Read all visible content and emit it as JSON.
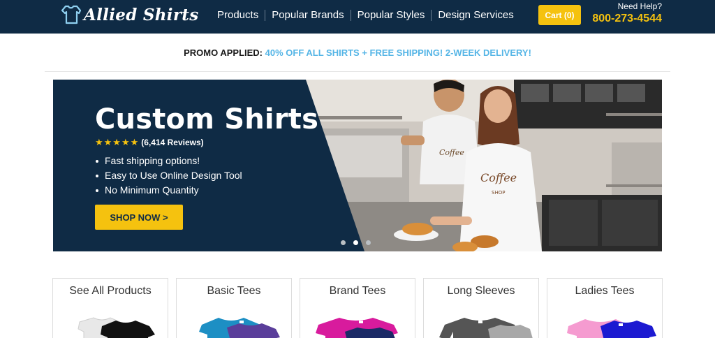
{
  "header": {
    "logo_text": "Allied Shirts",
    "nav": [
      "Products",
      "Popular Brands",
      "Popular Styles",
      "Design Services"
    ],
    "cart_label": "Cart (0)",
    "help_label": "Need Help?",
    "phone": "800-273-4544"
  },
  "promo": {
    "label": "PROMO APPLIED:",
    "text": "40% OFF ALL SHIRTS + FREE SHIPPING! 2-WEEK DELIVERY!"
  },
  "hero": {
    "title": "Custom Shirts",
    "rating_stars": 5,
    "stars_text": "★★★★★",
    "reviews": "(6,414 Reviews)",
    "bullets": [
      "Fast shipping options!",
      "Easy to Use Online Design Tool",
      "No Minimum Quantity"
    ],
    "cta": "SHOP NOW >",
    "slides": 3,
    "active_slide": 2,
    "shirt_prints": {
      "man": "Coffee",
      "woman": "Coffee",
      "woman_sub": "SHOP"
    }
  },
  "categories": [
    {
      "title": "See All Products",
      "colors": [
        "#e8e8e8",
        "#111111"
      ]
    },
    {
      "title": "Basic Tees",
      "colors": [
        "#1d8fc4",
        "#5a3e9a"
      ]
    },
    {
      "title": "Brand Tees",
      "colors": [
        "#d81b9d",
        "#1b2a66"
      ]
    },
    {
      "title": "Long Sleeves",
      "colors": [
        "#555555",
        "#a8a8a8"
      ]
    },
    {
      "title": "Ladies Tees",
      "colors": [
        "#f59bd0",
        "#1c1ad1"
      ]
    }
  ],
  "colors": {
    "navy": "#0f2b45",
    "gold": "#f5c20f",
    "promo_blue": "#55b5e6"
  }
}
